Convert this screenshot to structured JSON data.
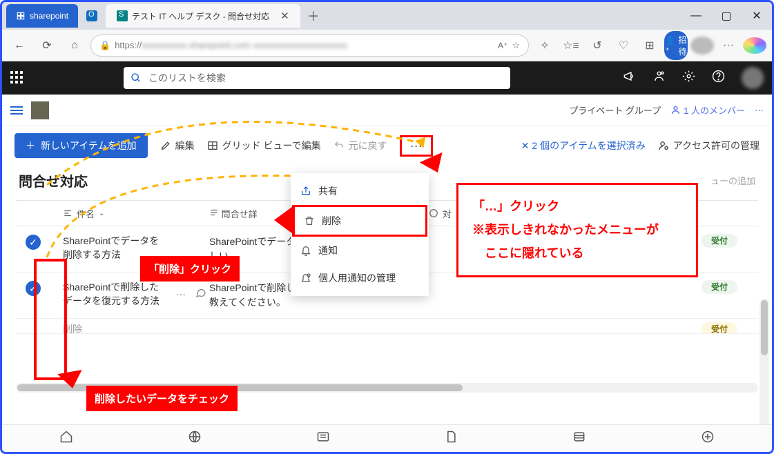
{
  "browser": {
    "tab1": "sharepoint",
    "tab_active": "テスト IT ヘルプ デスク - 問合せ対応",
    "url_scheme": "https://",
    "url_blur": "xxxxxxxxxx.sharepoint.com xxxxxxxxxxxxxxxxxxxxx",
    "invite": "招待"
  },
  "appbar": {
    "search_placeholder": "このリストを検索"
  },
  "subbar": {
    "group_label": "プライベート グループ",
    "members": "1 人のメンバー"
  },
  "cmd": {
    "add_item": "新しいアイテムを追加",
    "edit": "編集",
    "grid": "グリッド ビューで編集",
    "undo": "元に戻す",
    "more": "···",
    "sel_count": "2 個のアイテムを選択済み",
    "perm": "アクセス許可の管理"
  },
  "page": {
    "title": "問合せ対応",
    "add_view": "ューの追加"
  },
  "cols": {
    "name": "件名",
    "body_partial": "問合せ詳",
    "status_partial": "対"
  },
  "rows": [
    {
      "title": "SharePointでデータを削除する方法",
      "body": "SharePointでデータを削除する方法を教えてほしい",
      "status": "受付",
      "checked": true
    },
    {
      "title": "SharePointで削除したデータを復元する方法",
      "body": "SharePointで削除したデータを復元する方法を教えてください。",
      "status": "受付",
      "checked": true
    },
    {
      "title_partial": "削除",
      "status": "受付"
    }
  ],
  "popup": {
    "share": "共有",
    "delete": "削除",
    "notify": "通知",
    "manage_notify": "個人用通知の管理"
  },
  "annotations": {
    "delete_click": "「削除」クリック",
    "check_data": "削除したいデータをチェック",
    "more_click_line1": "「…」クリック",
    "more_click_line2": "※表示しきれなかったメニューが",
    "more_click_line3": "　ここに隠れている"
  }
}
